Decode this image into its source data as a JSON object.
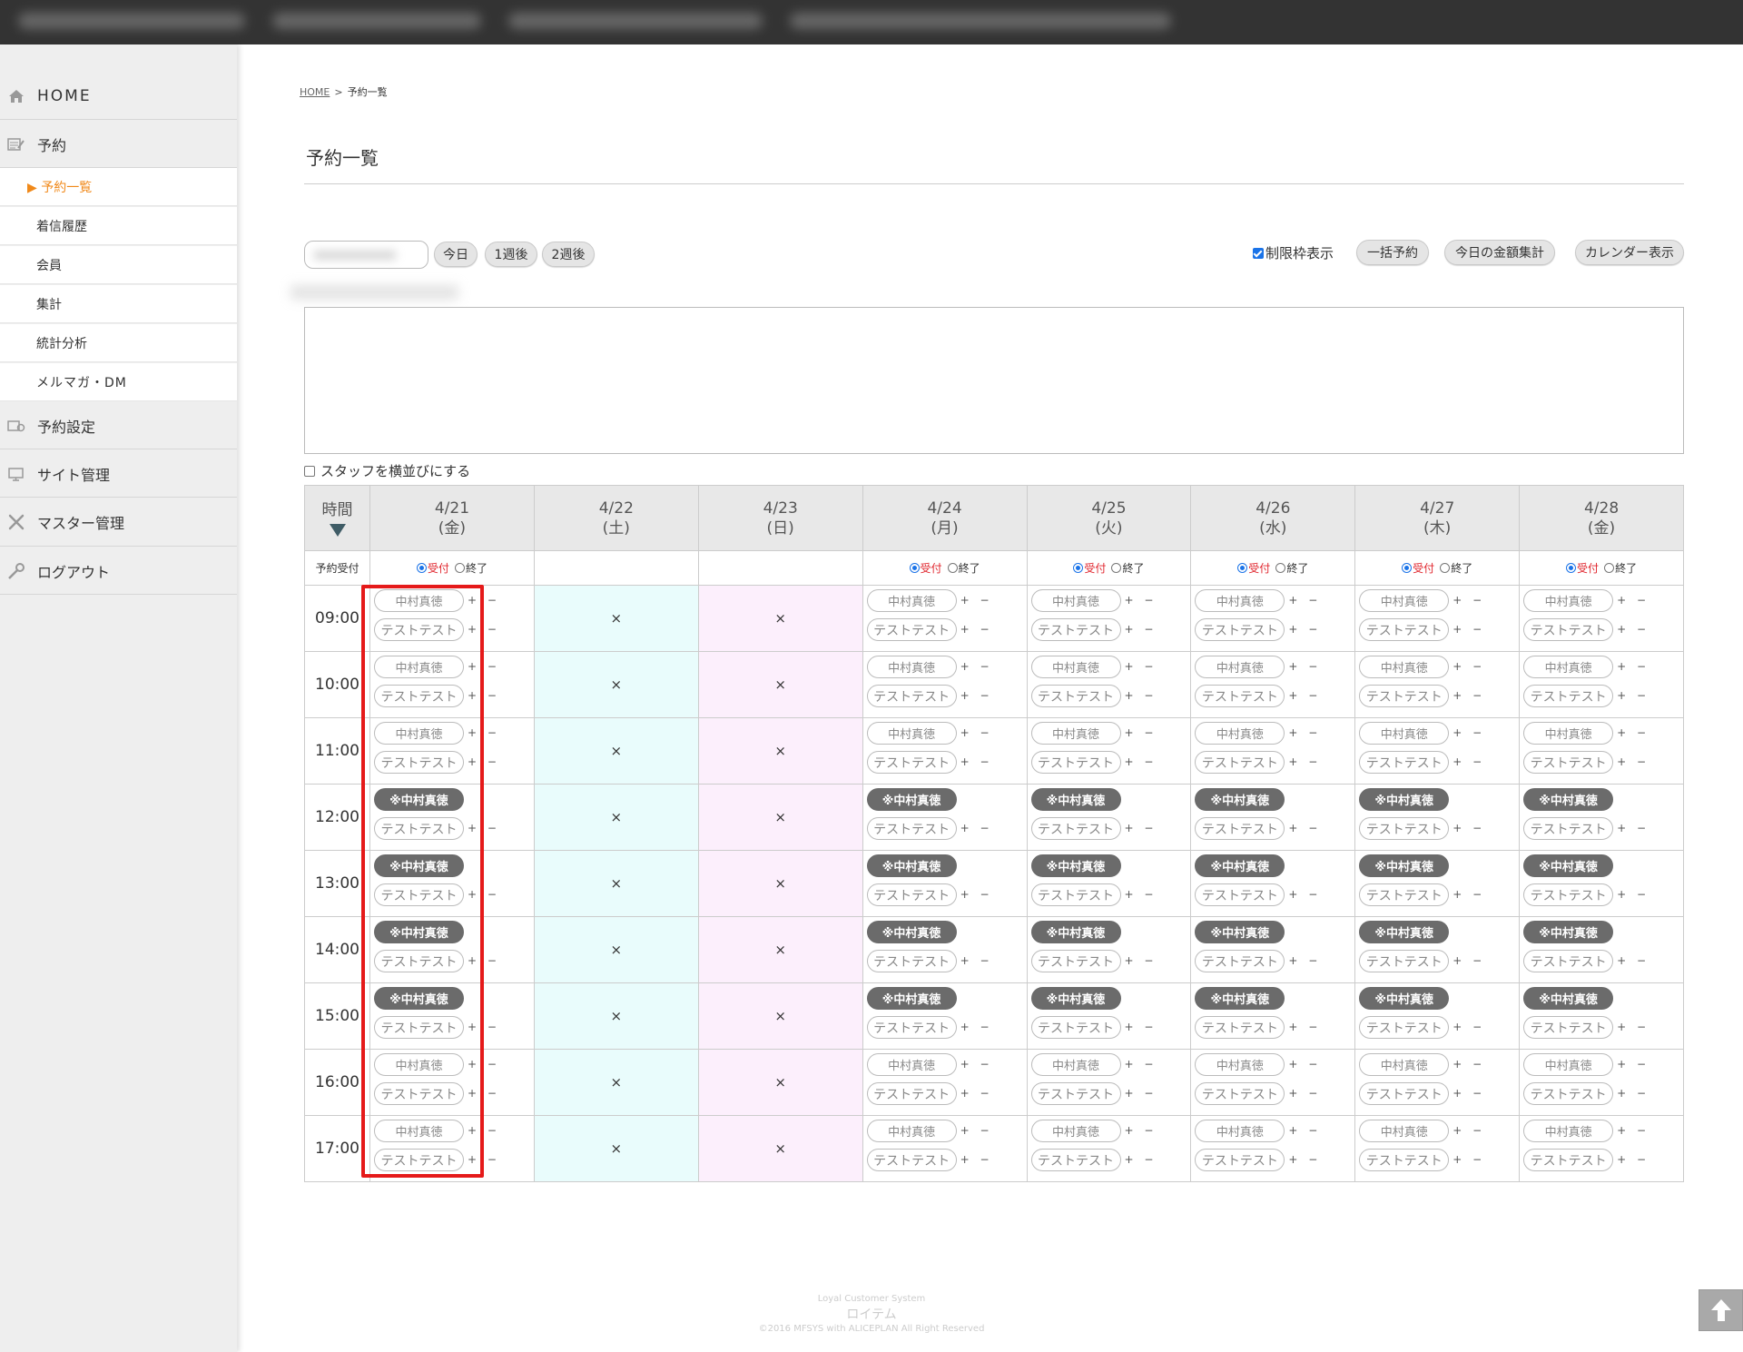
{
  "sidebar": {
    "home": "HOME",
    "yoyaku": "予約",
    "sub": [
      "予約一覧",
      "着信履歴",
      "会員",
      "集計",
      "統計分析",
      "メルマガ・DM"
    ],
    "yoyaku_settings": "予約設定",
    "site_admin": "サイト管理",
    "master_admin": "マスター管理",
    "logout": "ログアウト"
  },
  "breadcrumb": {
    "home": "HOME",
    "sep": ">",
    "current": "予約一覧"
  },
  "page_title": "予約一覧",
  "toolbar": {
    "today": "今日",
    "week1": "1週後",
    "week2": "2週後",
    "limit_check": "制限枠表示",
    "limit_checked": true,
    "bulk": "一括予約",
    "today_total": "今日の金額集計",
    "calendar": "カレンダー表示"
  },
  "staff_checkbox": "スタッフを横並びにする",
  "grid": {
    "corner": "時間",
    "uketsuke_label": "予約受付",
    "radio_on": "受付",
    "radio_off": "終了",
    "days": [
      {
        "date": "4/21",
        "dow": "(金)",
        "type": "open"
      },
      {
        "date": "4/22",
        "dow": "(土)",
        "type": "sat"
      },
      {
        "date": "4/23",
        "dow": "(日)",
        "type": "sun"
      },
      {
        "date": "4/24",
        "dow": "(月)",
        "type": "open"
      },
      {
        "date": "4/25",
        "dow": "(火)",
        "type": "open"
      },
      {
        "date": "4/26",
        "dow": "(水)",
        "type": "open"
      },
      {
        "date": "4/27",
        "dow": "(木)",
        "type": "open"
      },
      {
        "date": "4/28",
        "dow": "(金)",
        "type": "open"
      }
    ],
    "times": [
      "09:00",
      "10:00",
      "11:00",
      "12:00",
      "13:00",
      "14:00",
      "15:00",
      "16:00",
      "17:00"
    ],
    "booked_rows": [
      "12:00",
      "13:00",
      "14:00",
      "15:00"
    ],
    "staff1": "中村真徳",
    "staff1_booked": "※中村真徳",
    "staff2": "テストテスト",
    "plus_minus": "+ −",
    "closed_mark": "×"
  },
  "footer": {
    "line1": "Loyal Customer System",
    "line2": "ロイテム",
    "line3": "©2016 MFSYS with ALICEPLAN All Right Reserved"
  },
  "colors": {
    "accent_orange": "#f0891a",
    "highlight_red": "#e51a1a",
    "sat_bg": "#e9fcfc",
    "sun_bg": "#fceffc"
  }
}
